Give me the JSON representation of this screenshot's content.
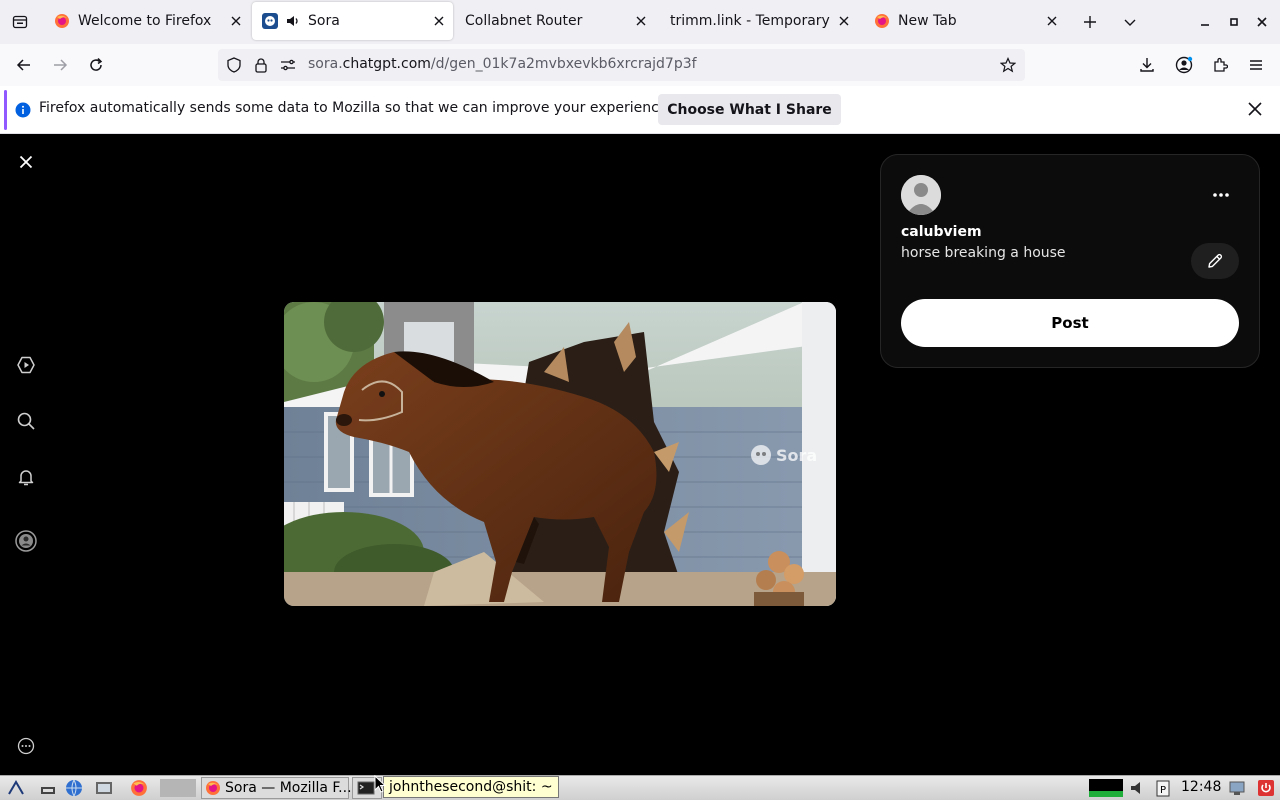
{
  "browser": {
    "tabs": [
      {
        "title": "Welcome to Firefox",
        "favicon": "firefox-icon",
        "active": false
      },
      {
        "title": "Sora",
        "favicon": "sora-icon",
        "audio": true,
        "active": true
      },
      {
        "title": "Collabnet Router",
        "favicon": "none",
        "active": false
      },
      {
        "title": "trimm.link - Temporary U",
        "favicon": "none",
        "active": false
      },
      {
        "title": "New Tab",
        "favicon": "firefox-icon",
        "active": false
      }
    ],
    "url": {
      "prefix": "sora.",
      "domain": "chatgpt.com",
      "path": "/d/gen_01k7a2mvbxevkb6xrcrajd7p3f"
    }
  },
  "notification": {
    "message": "Firefox automatically sends some data to Mozilla so that we can improve your experience.",
    "button_label": "Choose What I Share"
  },
  "sora": {
    "watermark": "Sora",
    "post": {
      "username": "calubviem",
      "prompt": "horse breaking a house",
      "post_label": "Post"
    },
    "sidebar_icons": [
      "play-icon",
      "search-icon",
      "bell-icon",
      "profile-icon",
      "more-icon"
    ]
  },
  "taskbar": {
    "tasks": [
      {
        "label": "Sora — Mozilla F...",
        "icon": "firefox-icon"
      },
      {
        "label": "",
        "icon": "terminal-icon"
      }
    ],
    "tooltip": "johnthesecond@shit: ~",
    "clock": "12:48"
  },
  "colors": {
    "accent": "#9059ff",
    "page_bg": "#000000",
    "post_button": "#ffffff"
  }
}
